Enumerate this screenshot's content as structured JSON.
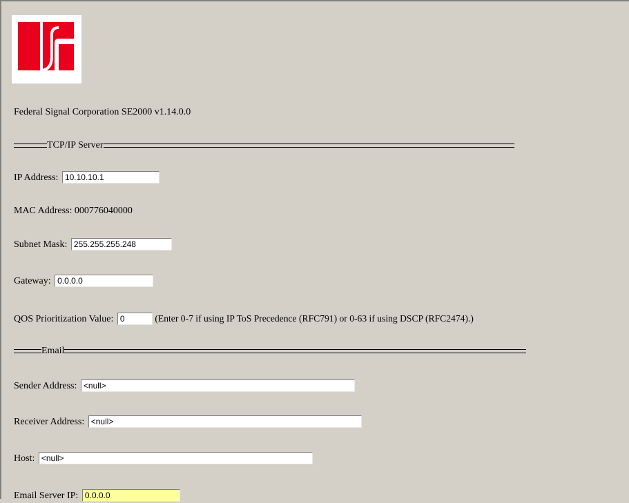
{
  "logo": {
    "name": "fs-logo",
    "color": "#e8001c"
  },
  "header": {
    "product": "Federal Signal Corporation SE2000 v1.14.0.0"
  },
  "tcpip": {
    "section_title": "TCP/IP Server",
    "ip_label": "IP Address:",
    "ip_value": "10.10.10.1",
    "mac_label": "MAC Address:",
    "mac_value": "000776040000",
    "subnet_label": "Subnet Mask:",
    "subnet_value": "255.255.255.248",
    "gateway_label": "Gateway:",
    "gateway_value": "0.0.0.0",
    "qos_label": "QOS Prioritization Value:",
    "qos_value": "0",
    "qos_hint": "(Enter 0-7 if using IP ToS Precedence (RFC791) or 0-63 if using DSCP (RFC2474).)"
  },
  "email": {
    "section_title": "Email",
    "sender_label": "Sender Address:",
    "sender_value": "<null>",
    "receiver_label": "Receiver Address:",
    "receiver_value": "<null>",
    "host_label": "Host:",
    "host_value": "<null>",
    "server_ip_label": "Email Server IP:",
    "server_ip_value": "0.0.0.0",
    "server_ip_highlight": "#ffffa0"
  }
}
